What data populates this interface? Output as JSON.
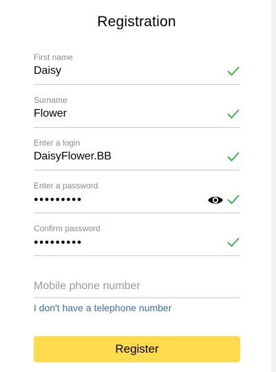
{
  "form": {
    "title": "Registration",
    "fields": [
      {
        "label": "First name",
        "value": "Daisy"
      },
      {
        "label": "Surname",
        "value": "Flower"
      },
      {
        "label": "Enter a login",
        "value": "DaisyFlower.BB"
      },
      {
        "label": "Enter a password",
        "value": "●●●●●●●●●"
      },
      {
        "label": "Confirm password",
        "value": "●●●●●●●●●"
      }
    ],
    "phone_placeholder": "Mobile phone number",
    "no_phone_link": "I don't have a telephone number",
    "register_label": "Register"
  },
  "colors": {
    "check": "#3bb54a",
    "button": "#ffdb4d",
    "link": "#3b6ea8"
  },
  "icons": {
    "valid": "check-icon",
    "reveal_password": "eye-icon"
  }
}
